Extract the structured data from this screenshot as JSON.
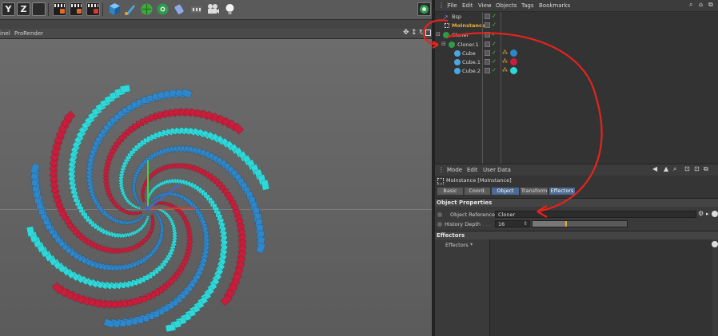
{
  "toolbar": {
    "axis_y": "Y",
    "axis_z": "Z",
    "icons": [
      "y-axis-icon",
      "z-axis-icon",
      "render-view-icon",
      "render-picture-viewer-icon",
      "edit-render-settings-icon",
      "cube-icon",
      "subdivision-icon",
      "mograph-icon",
      "deformer-icon",
      "scene-icon",
      "camera-icon",
      "light-icon"
    ]
  },
  "viewport": {
    "header_left": "inel",
    "header_right": "ProRender"
  },
  "menubar": {
    "items": [
      "File",
      "Edit",
      "View",
      "Objects",
      "Tags",
      "Bookmarks"
    ]
  },
  "objects": [
    {
      "name": "Bsp",
      "color": "#d8d8d8",
      "icon": "spline-icon"
    },
    {
      "name": "MoInstance",
      "color": "#f0b030",
      "icon": "moinstance-icon"
    },
    {
      "name": "Cloner",
      "color": "#d8d8d8",
      "icon": "cloner-icon"
    },
    {
      "name": "Cloner.1",
      "color": "#d8d8d8",
      "icon": "cloner-icon"
    },
    {
      "name": "Cube",
      "color": "#d8d8d8",
      "icon": "cube-object-icon"
    },
    {
      "name": "Cube.1",
      "color": "#d8d8d8",
      "icon": "cube-object-icon"
    },
    {
      "name": "Cube.2",
      "color": "#d8d8d8",
      "icon": "cube-object-icon"
    }
  ],
  "attr": {
    "menu": [
      "Mode",
      "Edit",
      "User Data"
    ],
    "object_name": "MoInstance [MoInstance]",
    "tabs": [
      "Basic",
      "Coord.",
      "Object",
      "Transform",
      "Effectors"
    ],
    "active_tab": "Object",
    "section_object": "Object Properties",
    "object_reference_label": "Object Reference",
    "object_reference_value": "Cloner",
    "history_depth_label": "History Depth",
    "history_depth_value": "16",
    "history_depth_fraction": 0.35,
    "section_effectors": "Effectors",
    "effectors_label": "Effectors"
  },
  "colors": {
    "cyan": "#2fd8d8",
    "blue": "#2f86c8",
    "red": "#c81e3c",
    "annotation": "#e8231c",
    "tab_active": "#4c6a92"
  }
}
